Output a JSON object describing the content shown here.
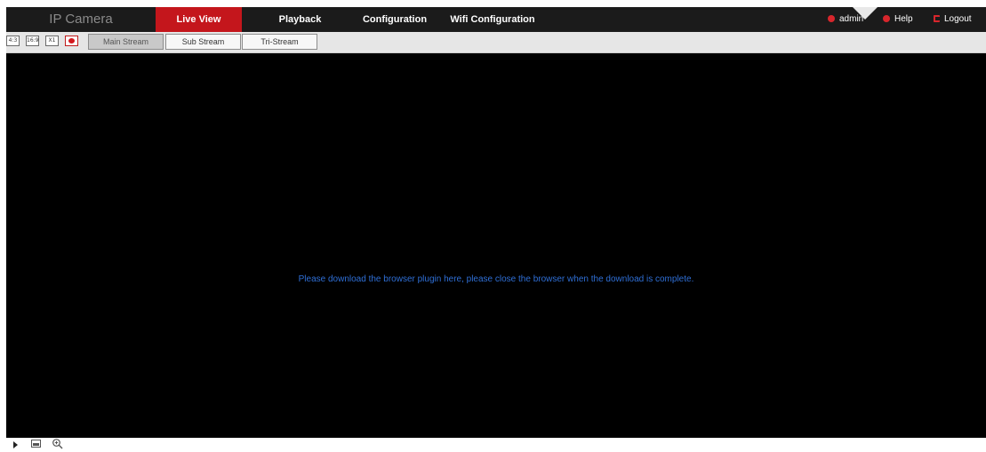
{
  "header": {
    "brand": "IP Camera",
    "tabs": [
      {
        "label": "Live View",
        "active": true
      },
      {
        "label": "Playback",
        "active": false
      },
      {
        "label": "Configuration",
        "active": false
      },
      {
        "label": "Wifi Configuration",
        "active": false
      }
    ],
    "user": {
      "admin_label": "admin",
      "help_label": "Help",
      "logout_label": "Logout"
    }
  },
  "toolbar": {
    "icons": [
      "4:3",
      "16:9",
      "X1",
      "record"
    ],
    "icon_labels": [
      "4:3",
      "16:9",
      "X1",
      ""
    ],
    "streams": [
      {
        "label": "Main Stream",
        "selected": true
      },
      {
        "label": "Sub Stream",
        "selected": false
      },
      {
        "label": "Tri-Stream",
        "selected": false
      }
    ]
  },
  "video": {
    "message": "Please download the browser plugin here, please close the browser when the download is complete."
  },
  "controls": {
    "icons": [
      "play-icon",
      "snapshot-icon",
      "zoom-in-icon"
    ]
  },
  "colors": {
    "accent": "#c4161c",
    "topbar": "#1b1b1b",
    "link": "#2f6fd6"
  }
}
